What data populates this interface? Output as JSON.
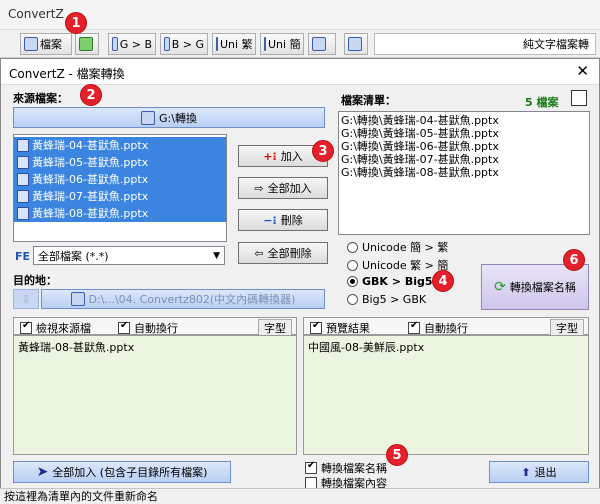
{
  "app": {
    "title": "ConvertZ"
  },
  "toolbar": {
    "buttons": [
      "檔案",
      "",
      "G > B",
      "B > G",
      "Uni 繁",
      "Uni 簡",
      "",
      ""
    ],
    "right_text": "純文字檔案轉"
  },
  "dialog": {
    "title": "ConvertZ - 檔案轉換",
    "close": "✕"
  },
  "source": {
    "label": "來源檔案：",
    "folder": "G:\\轉換",
    "files": [
      "黃蜂瑞-04-甚鼣魚.pptx",
      "黃蜂瑞-05-甚鼣魚.pptx",
      "黃蜂瑞-06-甚鼣魚.pptx",
      "黃蜂瑞-07-甚鼣魚.pptx",
      "黃蜂瑞-08-甚鼣魚.pptx"
    ],
    "fe": "FE",
    "filter": "全部檔案 (*.*)"
  },
  "filelist": {
    "label": "檔案清單：",
    "count": "5 檔案",
    "items": [
      "G:\\轉換\\黃蜂瑞-04-甚鼣魚.pptx",
      "G:\\轉換\\黃蜂瑞-05-甚鼣魚.pptx",
      "G:\\轉換\\黃蜂瑞-06-甚鼣魚.pptx",
      "G:\\轉換\\黃蜂瑞-07-甚鼣魚.pptx",
      "G:\\轉換\\黃蜂瑞-08-甚鼣魚.pptx"
    ]
  },
  "actions": {
    "add": "加入",
    "add_all": "全部加入",
    "remove": "刪除",
    "remove_all": "全部刪除"
  },
  "dest": {
    "label": "目的地：",
    "path": "D:\\...\\04. Convertz802(中文內碼轉換器)"
  },
  "modes": {
    "options": [
      "Unicode 簡 > 繁",
      "Unicode 繁 > 簡",
      "GBK > Big5",
      "Big5 > GBK"
    ],
    "selected": 2
  },
  "convert_btn": "轉換檔案名稱",
  "left_panel": {
    "check1": "檢視來源檔",
    "check2": "自動換行",
    "font": "字型",
    "content": "黃蜂瑞-08-甚鼣魚.pptx"
  },
  "right_panel": {
    "check1": "預覽結果",
    "check2": "自動換行",
    "font": "字型",
    "content": "中國風-08-美鮮辰.pptx"
  },
  "bottom": {
    "add_all_sub": "全部加入 (包含子目錄所有檔案)",
    "opt1": "轉換檔案名稱",
    "opt2": "轉換檔案內容",
    "exit": "退出"
  },
  "status": "按這裡為清單內的文件重新命名",
  "badges": [
    "1",
    "2",
    "3",
    "4",
    "5",
    "6"
  ],
  "colors": {
    "accent": "#3b84e0",
    "badge": "#e3202b",
    "panel": "#ebf5e0",
    "count": "#1a7a1a"
  }
}
